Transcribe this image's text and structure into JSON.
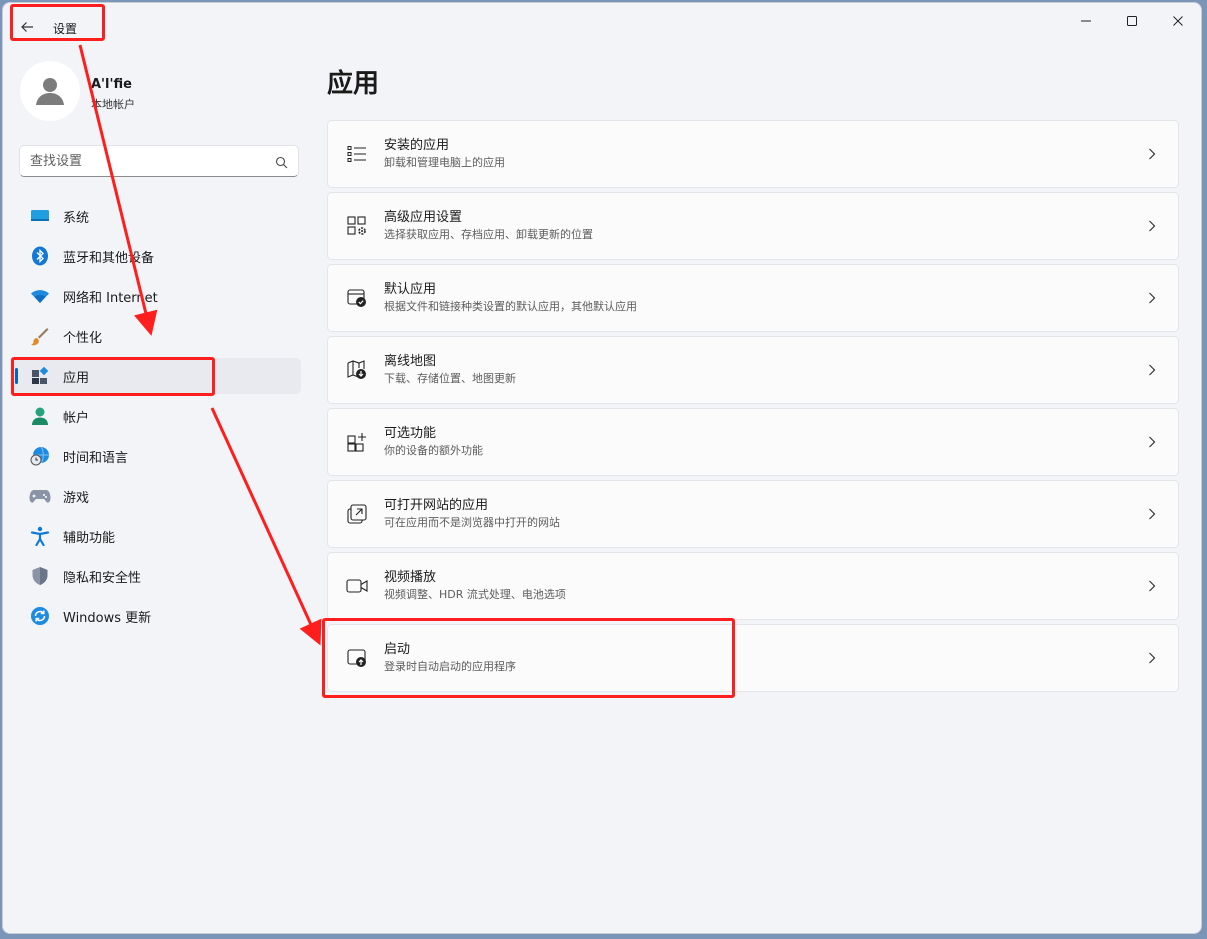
{
  "window": {
    "app_title": "设置",
    "controls": {
      "minimize": "minimize-icon",
      "maximize": "maximize-icon",
      "close": "close-icon"
    }
  },
  "profile": {
    "name": "A'l'fie",
    "account_type": "本地帐户"
  },
  "search": {
    "placeholder": "查找设置"
  },
  "sidebar": {
    "items": [
      {
        "label": "系统",
        "icon": "display-icon"
      },
      {
        "label": "蓝牙和其他设备",
        "icon": "bluetooth-icon"
      },
      {
        "label": "网络和 Internet",
        "icon": "wifi-icon"
      },
      {
        "label": "个性化",
        "icon": "brush-icon"
      },
      {
        "label": "应用",
        "icon": "apps-icon",
        "selected": true
      },
      {
        "label": "帐户",
        "icon": "person-icon"
      },
      {
        "label": "时间和语言",
        "icon": "globe-clock-icon"
      },
      {
        "label": "游戏",
        "icon": "gamepad-icon"
      },
      {
        "label": "辅助功能",
        "icon": "accessibility-icon"
      },
      {
        "label": "隐私和安全性",
        "icon": "shield-icon"
      },
      {
        "label": "Windows 更新",
        "icon": "update-icon"
      }
    ]
  },
  "main": {
    "title": "应用",
    "cards": [
      {
        "title": "安装的应用",
        "subtitle": "卸载和管理电脑上的应用",
        "icon": "list-icon"
      },
      {
        "title": "高级应用设置",
        "subtitle": "选择获取应用、存档应用、卸载更新的位置",
        "icon": "app-settings-icon"
      },
      {
        "title": "默认应用",
        "subtitle": "根据文件和链接种类设置的默认应用，其他默认应用",
        "icon": "default-app-icon"
      },
      {
        "title": "离线地图",
        "subtitle": "下载、存储位置、地图更新",
        "icon": "map-download-icon"
      },
      {
        "title": "可选功能",
        "subtitle": "你的设备的额外功能",
        "icon": "add-feature-icon"
      },
      {
        "title": "可打开网站的应用",
        "subtitle": "可在应用而不是浏览器中打开的网站",
        "icon": "open-external-icon"
      },
      {
        "title": "视频播放",
        "subtitle": "视频调整、HDR 流式处理、电池选项",
        "icon": "video-camera-icon"
      },
      {
        "title": "启动",
        "subtitle": "登录时自动启动的应用程序",
        "icon": "startup-icon"
      }
    ]
  },
  "colors": {
    "annotation": "#ff1e1e",
    "accent": "#0067c0",
    "window_bg": "#f3f4f8",
    "card_bg": "#fbfbfc"
  }
}
